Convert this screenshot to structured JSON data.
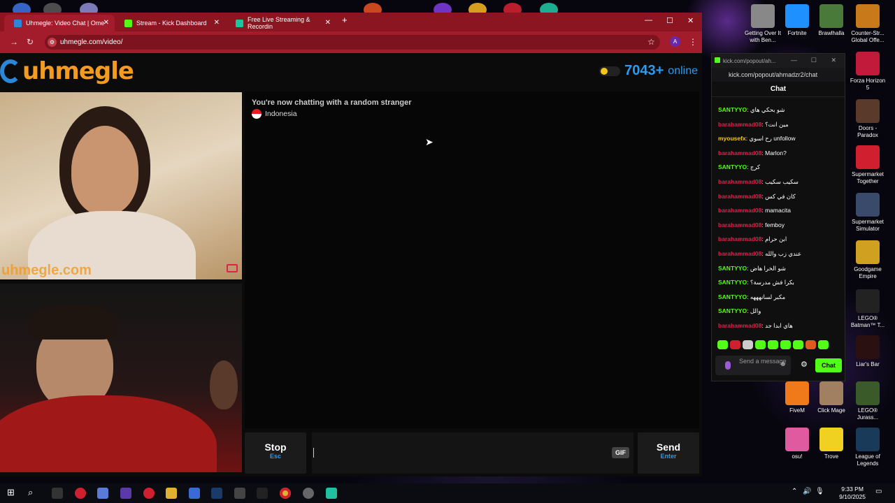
{
  "browser": {
    "tabs": [
      {
        "label": "Uhmegle: Video Chat | Ome",
        "active": true,
        "icon_color": "#2b88d8"
      },
      {
        "label": "Stream - Kick Dashboard",
        "active": false,
        "icon_color": "#53fc18"
      },
      {
        "label": "Free Live Streaming & Recordin",
        "active": false,
        "icon_color": "#18c7a0"
      }
    ],
    "url": "uhmegle.com/video/",
    "profile_letter": "A"
  },
  "page": {
    "logo_text": "uhmegle",
    "online_count": "7043+",
    "online_label": "online",
    "watermark": "uhmegle.com",
    "chat_status": "You're now chatting with a random stranger",
    "country": "Indonesia",
    "stop_label": "Stop",
    "stop_key": "Esc",
    "gif_label": "GIF",
    "send_label": "Send",
    "send_key": "Enter"
  },
  "kick": {
    "window_title": "kick.com/popout/ah...",
    "url": "kick.com/popout/ahmadzr2/chat",
    "header": "Chat",
    "input_placeholder": "Send a message",
    "send_label": "Chat",
    "messages": [
      {
        "user": "SANTYYO",
        "text": "شو بحكي هاي",
        "color": "#53fc18"
      },
      {
        "user": "barahammad08",
        "text": "مين انت؟",
        "color": "#e0224a"
      },
      {
        "user": "myousefx",
        "text": "رح اسوي unfollow",
        "color": "#f5c518"
      },
      {
        "user": "barahammad08",
        "text": "Marlon?",
        "color": "#e0224a"
      },
      {
        "user": "SANTYYO",
        "text": "كرج",
        "color": "#53fc18"
      },
      {
        "user": "barahammad08",
        "text": "سكيب سكيب",
        "color": "#e0224a"
      },
      {
        "user": "barahammad08",
        "text": "كان في كس",
        "color": "#e0224a"
      },
      {
        "user": "barahammad08",
        "text": "mamacita",
        "color": "#e0224a"
      },
      {
        "user": "barahammad08",
        "text": "femboy",
        "color": "#e0224a"
      },
      {
        "user": "barahammad08",
        "text": "ابن حرام",
        "color": "#e0224a"
      },
      {
        "user": "barahammad08",
        "text": "عندي زب والله",
        "color": "#e0224a"
      },
      {
        "user": "SANTYYO",
        "text": "شو الخرا هاض",
        "color": "#53fc18"
      },
      {
        "user": "SANTYYO",
        "text": "بكرا فش مدرسة؟",
        "color": "#53fc18"
      },
      {
        "user": "SANTYYO",
        "text": "مكبر لسانهههه",
        "color": "#53fc18"
      },
      {
        "user": "SANTYYO",
        "text": "والل",
        "color": "#53fc18"
      },
      {
        "user": "barahammad08",
        "text": "هاي ابدا جد",
        "color": "#e0224a"
      }
    ]
  },
  "desktop_icons": [
    {
      "label": "Getting Over It with Ben...",
      "color": "#888"
    },
    {
      "label": "Fortnite",
      "color": "#1e90ff"
    },
    {
      "label": "Brawlhalla",
      "color": "#4a7a3a"
    },
    {
      "label": "Counter-Str... Global Offe...",
      "color": "#c87a1a"
    },
    {
      "label": "Forza Horizon 5",
      "color": "#c21a3a"
    },
    {
      "label": "Doors - Paradox",
      "color": "#5a3a2a"
    },
    {
      "label": "Supermarket Together",
      "color": "#d02030"
    },
    {
      "label": "Supermarket Simulator",
      "color": "#3a4a6a"
    },
    {
      "label": "Goodgame Empire",
      "color": "#d0a020"
    },
    {
      "label": "LEGO® Batman™ T...",
      "color": "#222"
    },
    {
      "label": "Liar's Bar",
      "color": "#2a1010"
    },
    {
      "label": "FiveM",
      "color": "#f07a1a"
    },
    {
      "label": "Click Mage",
      "color": "#a08060"
    },
    {
      "label": "LEGO® Jurass...",
      "color": "#3a5a2a"
    },
    {
      "label": "osu!",
      "color": "#e05aa0"
    },
    {
      "label": "Trove",
      "color": "#f0d020"
    },
    {
      "label": "League of Legends",
      "color": "#1a3a5a"
    }
  ],
  "taskbar": {
    "time": "9:33 PM",
    "date": "9/10/2025"
  }
}
